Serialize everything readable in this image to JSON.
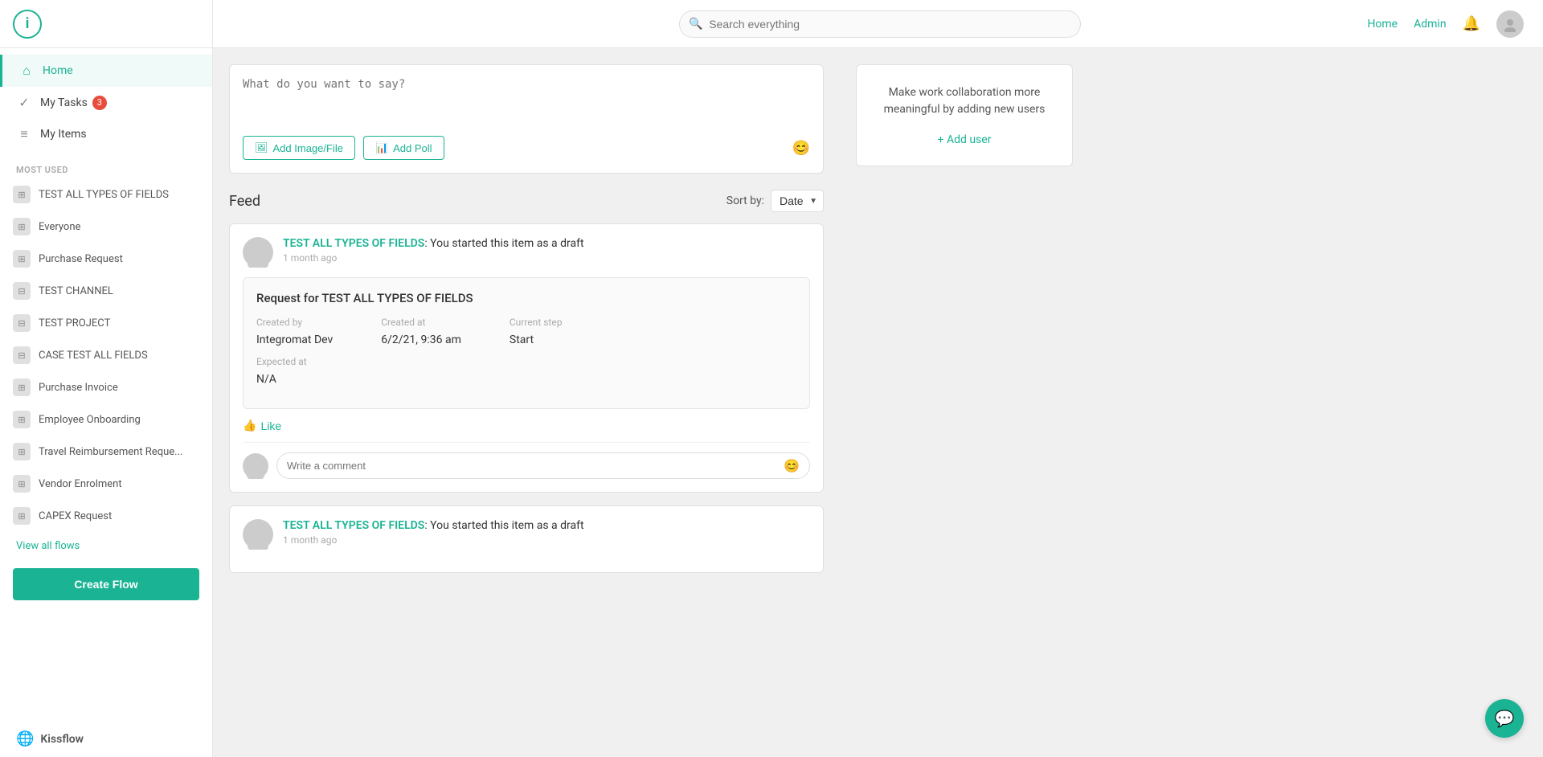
{
  "app": {
    "logo_letter": "i",
    "title": "Kissflow"
  },
  "header": {
    "search_placeholder": "Search everything",
    "home_link": "Home",
    "admin_link": "Admin"
  },
  "sidebar": {
    "nav": [
      {
        "id": "home",
        "label": "Home",
        "icon": "⌂",
        "active": true
      },
      {
        "id": "my-tasks",
        "label": "My Tasks",
        "icon": "✓",
        "badge": "3"
      },
      {
        "id": "my-items",
        "label": "My Items",
        "icon": "≡"
      }
    ],
    "section_label": "MOST USED",
    "flows": [
      {
        "id": "test-all-types",
        "label": "TEST ALL TYPES OF FIELDS",
        "icon": "⊞"
      },
      {
        "id": "everyone",
        "label": "Everyone",
        "icon": "⊞"
      },
      {
        "id": "purchase-request",
        "label": "Purchase Request",
        "icon": "⊞"
      },
      {
        "id": "test-channel",
        "label": "TEST CHANNEL",
        "icon": "⊟"
      },
      {
        "id": "test-project",
        "label": "TEST PROJECT",
        "icon": "⊟"
      },
      {
        "id": "case-test-all-fields",
        "label": "CASE TEST ALL FIELDS",
        "icon": "⊟"
      },
      {
        "id": "purchase-invoice",
        "label": "Purchase Invoice",
        "icon": "⊞"
      },
      {
        "id": "employee-onboarding",
        "label": "Employee Onboarding",
        "icon": "⊞"
      },
      {
        "id": "travel-reimbursement",
        "label": "Travel Reimbursement Reque...",
        "icon": "⊞"
      },
      {
        "id": "vendor-enrolment",
        "label": "Vendor Enrolment",
        "icon": "⊞"
      },
      {
        "id": "capex-request",
        "label": "CAPEX Request",
        "icon": "⊞"
      }
    ],
    "view_all_label": "View all flows",
    "create_flow_label": "Create Flow"
  },
  "post_box": {
    "placeholder": "What do you want to say?",
    "add_image_label": "Add Image/File",
    "add_poll_label": "Add Poll"
  },
  "feed": {
    "title": "Feed",
    "sort_label": "Sort by:",
    "sort_option": "Date",
    "items": [
      {
        "id": "feed-1",
        "flow_name": "TEST ALL TYPES OF FIELDS",
        "message": ": You started this item as a draft",
        "time": "1 month ago",
        "request_title": "Request for TEST ALL TYPES OF FIELDS",
        "created_by_label": "Created by",
        "created_by": "Integromat Dev",
        "created_at_label": "Created at",
        "created_at": "6/2/21, 9:36 am",
        "current_step_label": "Current step",
        "current_step": "Start",
        "expected_at_label": "Expected at",
        "expected_at": "N/A",
        "like_label": "Like",
        "comment_placeholder": "Write a comment"
      },
      {
        "id": "feed-2",
        "flow_name": "TEST ALL TYPES OF FIELDS",
        "message": ": You started this item as a draft",
        "time": "1 month ago"
      }
    ]
  },
  "right_panel": {
    "add_user_text": "Make work collaboration more meaningful by adding new users",
    "add_user_link": "+ Add user"
  },
  "chat_fab": {
    "icon": "💬"
  }
}
